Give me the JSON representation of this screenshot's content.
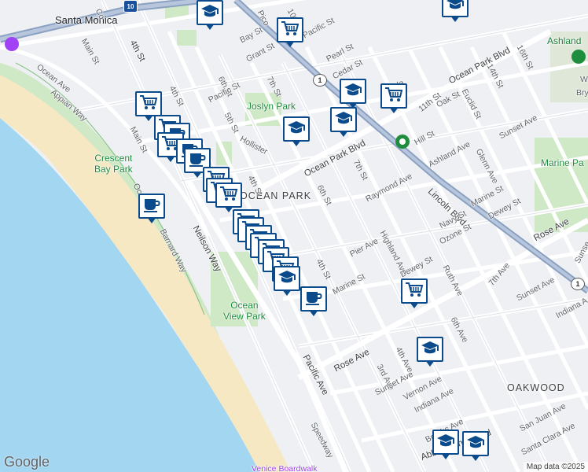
{
  "map": {
    "place_labels": {
      "santa_monica": "Santa Monica",
      "ocean_park": "OCEAN PARK",
      "oakwood": "OAKWOOD",
      "marine_park": "Marine Pa",
      "venice_boardwalk": "Venice Boardwalk"
    },
    "parks": {
      "joslyn": "Joslyn Park",
      "crescent_bay": "Crescent\nBay Park",
      "ocean_view": "Ocean\nView Park"
    },
    "poi": {
      "ashland": "Ashland",
      "w": "W",
      "bry": "Bry"
    },
    "streets": {
      "ocean_ave": "Ocean Ave",
      "appian_way": "Appian Way",
      "main_st_top": "Main St",
      "fourth_st_top": "4th St",
      "fourth_st_mid": "4th St",
      "fourth_st_low": "4th St",
      "fourth_st_upper": "4th St",
      "sixth_st_top": "6th St",
      "sixth_st_mid": "6th St",
      "fifth_st": "5th St",
      "seventh_st_top": "7th St",
      "seventh_st_mid": "7th St",
      "seventh_ave": "7th Ave",
      "tenth_st": "10th St",
      "eleventh_st": "11th St",
      "fourteenth_st": "14th St",
      "sixteenth_st": "16th St",
      "bay_st": "Bay St",
      "grant_st": "Grant St",
      "pacific_st_top": "Pacific St",
      "pacific_st_left": "Pacific St",
      "pearl_st": "Pearl St",
      "cedar_st": "Cedar St",
      "maple": "Maple",
      "oak_st": "Oak St",
      "euclid_st": "Euclid St",
      "hill_st": "Hill St",
      "hollister": "Hollister",
      "ocean_park_blvd_left": "Ocean Park Blvd",
      "ocean_park_blvd_right": "Ocean Park Blvd",
      "lincoln_blvd": "Lincoln Blvd",
      "ashland_ave": "Ashland Ave",
      "glenn_ave": "Glenn Ave",
      "sunset_ave_top": "Sunset Ave",
      "raymond_ave": "Raymond Ave",
      "marine_st_top": "Marine St",
      "marine_st_low": "Marine St",
      "dewey_st_top": "Dewey St",
      "dewey_st_low": "Dewey St",
      "navy_st": "Navy St",
      "ozone_st": "Ozone St",
      "highland_ave": "Highland Ave",
      "pier_ave": "Pier Ave",
      "ruth_ave": "Ruth Ave",
      "rose_ave_right": "Rose Ave",
      "rose_ave_low": "Rose Ave",
      "neilson_way": "Neilson Way",
      "barnard_way": "Barnard Way",
      "pacific_ave": "Pacific Ave",
      "speedway": "Speedway",
      "sixth_ave": "6th Ave",
      "fourth_ave": "4th Ave",
      "third_ave": "3rd Ave",
      "sunset_ave_mid": "Sunset Ave",
      "sunset_ave_low": "Sunset Ave",
      "vernon_ave": "Vernon Ave",
      "indiana_ave_low": "Indiana Ave",
      "indiana_ave_right": "Indiana A",
      "brooks_ave": "Brooks Ave",
      "san_juan_ave": "San Juan Ave",
      "santa_clara_ave": "Santa Clara Ave",
      "abbot_kinney_blvd": "Abbot Kinney Blvd",
      "sunset_right": "Sunse",
      "main_st_left": "Main St",
      "ocean_left": "Ocea",
      "pico": "Pico",
      "co": "Co"
    },
    "shields": {
      "i10": "10",
      "ca1_top": "1",
      "ca1_right": "1"
    },
    "markers": [
      {
        "type": "school-icon"
      },
      {
        "type": "school-icon"
      },
      {
        "type": "grocery-icon"
      },
      {
        "type": "school-icon"
      },
      {
        "type": "grocery-icon"
      },
      {
        "type": "school-icon"
      },
      {
        "type": "grocery-icon"
      },
      {
        "type": "school-icon"
      },
      {
        "type": "grocery-icon"
      },
      {
        "type": "cafe-icon"
      },
      {
        "type": "grocery-icon"
      },
      {
        "type": "cafe-icon"
      },
      {
        "type": "cafe-icon"
      },
      {
        "type": "grocery-icon"
      },
      {
        "type": "cafe-icon"
      },
      {
        "type": "grocery-icon"
      },
      {
        "type": "grocery-icon"
      },
      {
        "type": "grocery-icon"
      },
      {
        "type": "grocery-icon"
      },
      {
        "type": "grocery-icon"
      },
      {
        "type": "grocery-icon"
      },
      {
        "type": "grocery-icon"
      },
      {
        "type": "grocery-icon"
      },
      {
        "type": "grocery-icon"
      },
      {
        "type": "cafe-icon"
      },
      {
        "type": "grocery-icon"
      },
      {
        "type": "school-icon"
      },
      {
        "type": "school-icon"
      },
      {
        "type": "school-icon"
      },
      {
        "type": "school-icon"
      }
    ],
    "branding": "Google",
    "attribution": "Map data ©2025",
    "colors": {
      "ocean": "#a3d6f0",
      "beach": "#f5e8c3",
      "park": "#cfe8c5",
      "marker_border": "#0b4a8b",
      "highway": "#8aa1c1"
    }
  }
}
